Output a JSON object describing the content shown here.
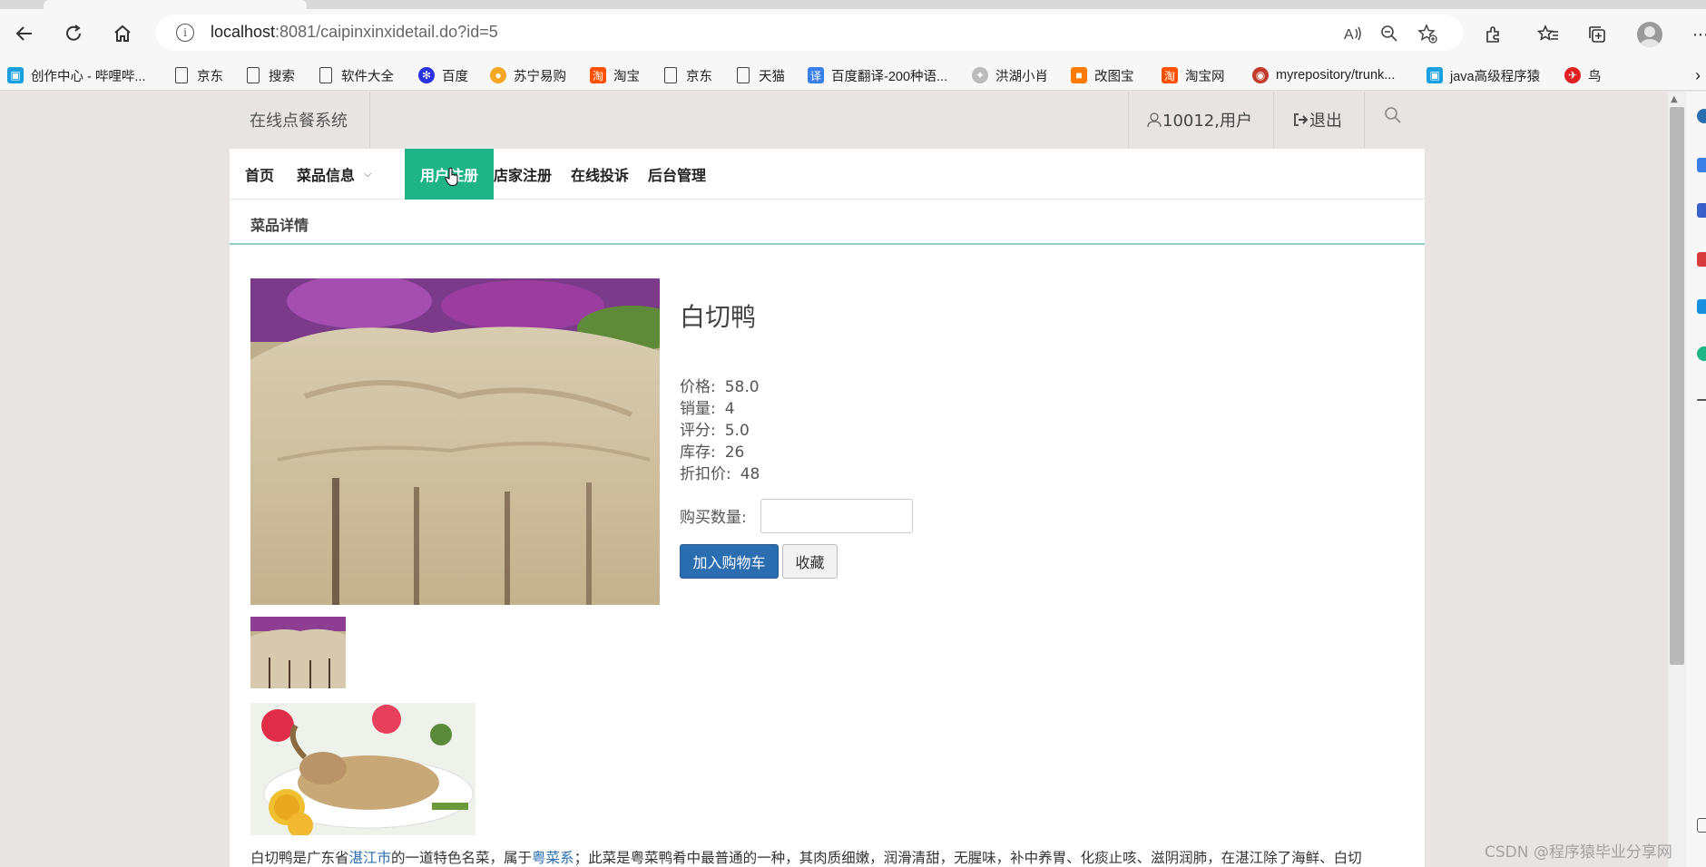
{
  "browser": {
    "url_host": "localhost",
    "url_path": ":8081/caipinxinxidetail.do?id=5",
    "bookmarks": [
      {
        "label": "创作中心 - 哔哩哔...",
        "icon": "bilibili-icon",
        "color": "#1a9fe0"
      },
      {
        "label": "京东",
        "icon": "document-icon"
      },
      {
        "label": "搜索",
        "icon": "document-icon"
      },
      {
        "label": "软件大全",
        "icon": "document-icon"
      },
      {
        "label": "百度",
        "icon": "baidu-paw-icon",
        "color": "#2932e1"
      },
      {
        "label": "苏宁易购",
        "icon": "suning-icon",
        "color": "#f5a623"
      },
      {
        "label": "淘宝",
        "icon": "taobao-icon",
        "color": "#ff5000"
      },
      {
        "label": "京东",
        "icon": "document-icon"
      },
      {
        "label": "天猫",
        "icon": "document-icon"
      },
      {
        "label": "百度翻译-200种语...",
        "icon": "baidu-translate-icon",
        "color": "#3a7ee8"
      },
      {
        "label": "洪湖小肖",
        "icon": "bird-icon",
        "color": "#888888"
      },
      {
        "label": "改图宝",
        "icon": "gaitubao-icon",
        "color": "#ff7a00"
      },
      {
        "label": "淘宝网",
        "icon": "taobao-icon",
        "color": "#ff5000"
      },
      {
        "label": "myrepository/trunk...",
        "icon": "repo-icon",
        "color": "#c0392b"
      },
      {
        "label": "java高级程序猿",
        "icon": "bilibili-icon",
        "color": "#1a9fe0"
      },
      {
        "label": "鸟",
        "icon": "bird-red-icon",
        "color": "#e02020"
      }
    ]
  },
  "site": {
    "title": "在线点餐系统",
    "user": "10012,用户",
    "logout": "退出"
  },
  "nav": {
    "home": "首页",
    "dishes": "菜品信息",
    "user_register": "用户注册",
    "shop_register": "店家注册",
    "complaint": "在线投诉",
    "admin": "后台管理"
  },
  "section": {
    "title": "菜品详情"
  },
  "dish": {
    "name": "白切鸭",
    "attrs": [
      {
        "label": "价格:",
        "value": "58.0"
      },
      {
        "label": "销量:",
        "value": "4"
      },
      {
        "label": "评分:",
        "value": "5.0"
      },
      {
        "label": "库存:",
        "value": "26"
      },
      {
        "label": "折扣价:",
        "value": "48"
      }
    ],
    "qty_label": "购买数量:",
    "add_cart": "加入购物车",
    "favorite": "收藏",
    "description_parts": {
      "p1": "白切鸭是广东省",
      "link1": "湛江市",
      "p2": "的一道特色名菜，属于",
      "link2": "粤菜系",
      "p3": "；此菜是粤菜鸭肴中最普通的一种，其肉质细嫩，润滑清甜，无腥味，补中养胃、化痰止咳、滋阴润肺，在湛江除了海鲜、白切"
    }
  },
  "watermark": "CSDN @程序猿毕业分享网",
  "colors": {
    "accent": "#1eb486",
    "primary_button": "#2a6db0",
    "page_bg": "#e8e4e4"
  }
}
